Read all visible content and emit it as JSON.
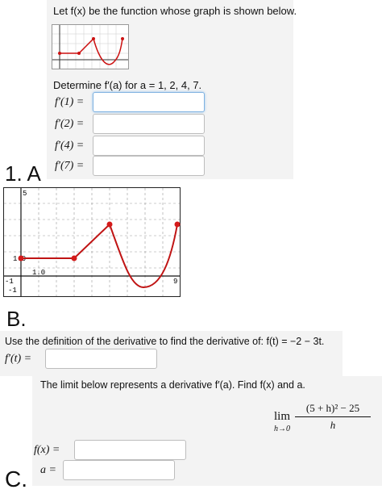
{
  "sectionA": {
    "intro": "Let f(x) be the function whose graph is shown below.",
    "determine": "Determine f′(a) for a = 1, 2, 4, 7.",
    "labels": [
      "f′(1) =",
      "f′(2) =",
      "f′(4) =",
      "f′(7) =",
      "f′(7) ="
    ],
    "big_label": "1. A",
    "graph": {
      "y_top_label": "5",
      "y_mid_label": "1.0",
      "x_mid_label": "1.0",
      "x_left_label": "-1",
      "y_bottom_label": "-1",
      "x_right_label": "9"
    }
  },
  "sectionB": {
    "big_label": "B.",
    "prompt": "Use the definition of the derivative to find the derivative of: f(t) = −2 − 3t.",
    "answer_label": "f′(t) ="
  },
  "sectionC": {
    "big_label": "C.",
    "prompt": "The limit below represents a derivative f′(a). Find f(x) and a.",
    "lim_word": "lim",
    "lim_sub": "h→0",
    "numerator": "(5 + h)² − 25",
    "denominator": "h",
    "fx_label": "f(x) =",
    "a_label": "a ="
  }
}
